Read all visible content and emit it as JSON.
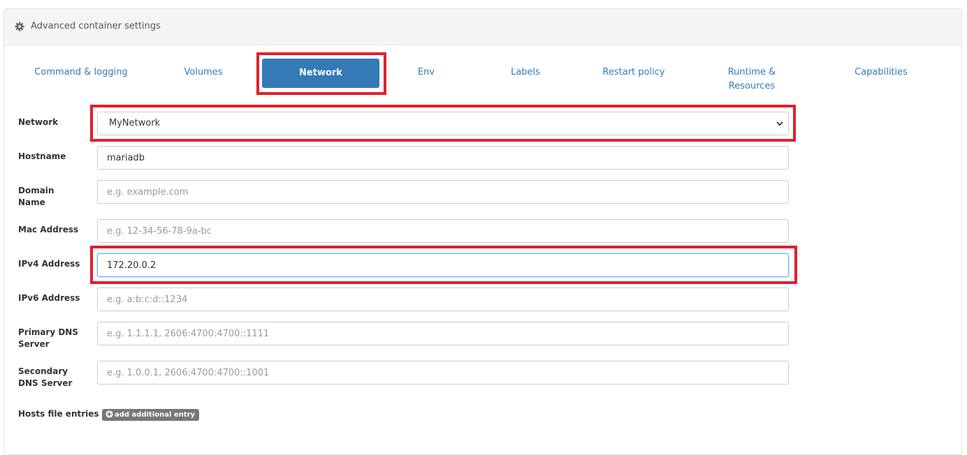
{
  "panel": {
    "title": "Advanced container settings",
    "icon": "gear-icon"
  },
  "tabs": [
    {
      "label": "Command & logging"
    },
    {
      "label": "Volumes"
    },
    {
      "label": "Network"
    },
    {
      "label": "Env"
    },
    {
      "label": "Labels"
    },
    {
      "label": "Restart policy"
    },
    {
      "label_line1": "Runtime &",
      "label_line2": "Resources"
    },
    {
      "label": "Capabilities"
    }
  ],
  "form": {
    "network": {
      "label": "Network",
      "value": "MyNetwork"
    },
    "hostname": {
      "label": "Hostname",
      "value": "mariadb"
    },
    "domain": {
      "label_line1": "Domain",
      "label_line2": "Name",
      "placeholder": "e.g. example.com"
    },
    "mac": {
      "label": "Mac Address",
      "placeholder": "e.g. 12-34-56-78-9a-bc"
    },
    "ipv4": {
      "label": "IPv4 Address",
      "value": "172.20.0.2"
    },
    "ipv6": {
      "label": "IPv6 Address",
      "placeholder": "e.g. a:b:c:d::1234"
    },
    "dns1": {
      "label_line1": "Primary DNS",
      "label_line2": "Server",
      "placeholder": "e.g. 1.1.1.1, 2606:4700:4700::1111"
    },
    "dns2": {
      "label_line1": "Secondary",
      "label_line2": "DNS Server",
      "placeholder": "e.g. 1.0.0.1, 2606:4700:4700::1001"
    },
    "hosts": {
      "label": "Hosts file entries",
      "add_label": "add additional entry"
    }
  },
  "colors": {
    "accent": "#337ab7",
    "highlight": "#e0202e",
    "badge": "#777777"
  }
}
